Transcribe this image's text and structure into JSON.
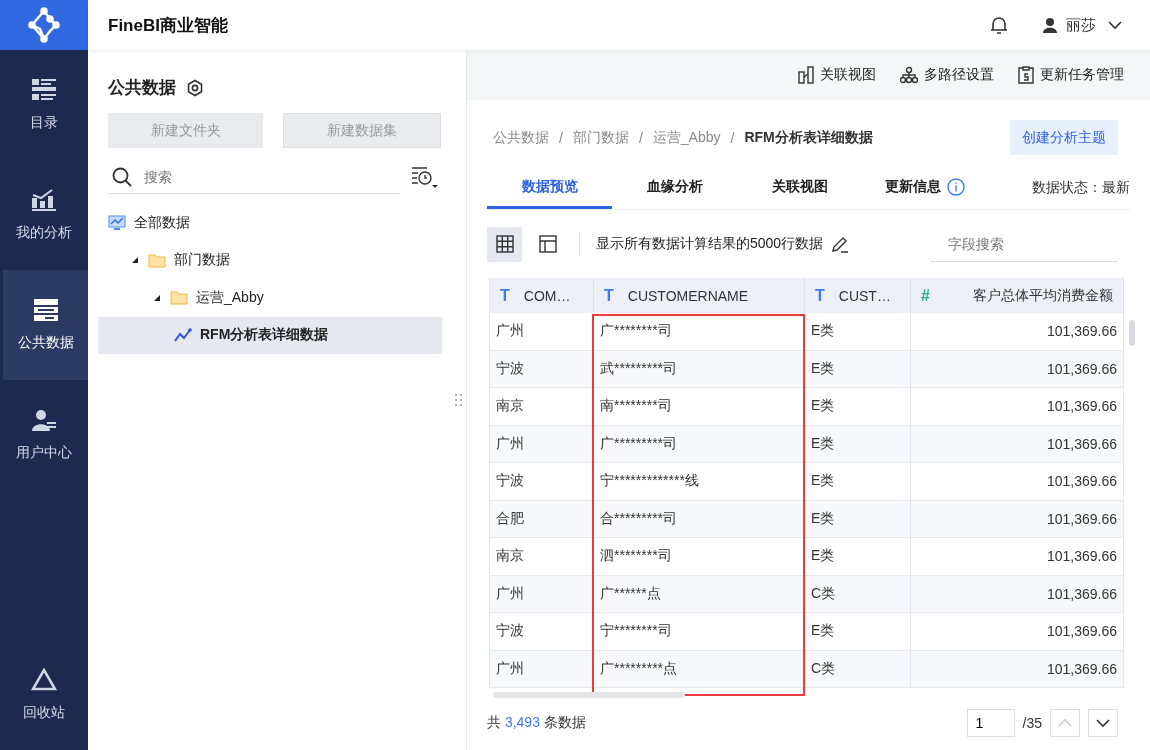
{
  "app": {
    "title": "FineBI商业智能",
    "user": "丽莎"
  },
  "nav": [
    {
      "label": "目录",
      "selected": false
    },
    {
      "label": "我的分析",
      "selected": false
    },
    {
      "label": "公共数据",
      "selected": true
    },
    {
      "label": "用户中心",
      "selected": false
    }
  ],
  "nav_bottom": {
    "label": "回收站"
  },
  "left_panel": {
    "title": "公共数据",
    "buttons": [
      {
        "label": "新建文件夹",
        "disabled": true
      },
      {
        "label": "新建数据集",
        "disabled": true
      }
    ],
    "search": {
      "placeholder": "搜索"
    },
    "tree": [
      {
        "label": "全部数据",
        "kind": "root",
        "selected": false,
        "children": [
          {
            "label": "部门数据",
            "kind": "folder",
            "expanded": true,
            "selected": false,
            "children": [
              {
                "label": "运营_Abby",
                "kind": "folder",
                "expanded": true,
                "selected": false,
                "children": [
                  {
                    "label": "RFM分析表详细数据",
                    "kind": "dataset",
                    "selected": true
                  }
                ]
              }
            ]
          }
        ]
      }
    ]
  },
  "toolbar": [
    "关联视图",
    "多路径设置",
    "更新任务管理"
  ],
  "breadcrumb": {
    "separator": "/",
    "items": [
      "公共数据",
      "部门数据",
      "运营_Abby",
      "RFM分析表详细数据"
    ]
  },
  "create_button": "创建分析主题",
  "tabs": [
    {
      "label": "数据预览",
      "selected": true
    },
    {
      "label": "血缘分析",
      "selected": false
    },
    {
      "label": "关联视图",
      "selected": false
    },
    {
      "label": "更新信息",
      "selected": false
    }
  ],
  "data_status": "数据状态：最新",
  "view_modes": [
    {
      "kind": "grid",
      "selected": true
    },
    {
      "kind": "layout",
      "selected": false
    }
  ],
  "row_notice": "显示所有数据计算结果的5000行数据",
  "field_search": {
    "placeholder": "字段搜索"
  },
  "table": {
    "columns": [
      {
        "type_icon": "T",
        "label": "COM…",
        "kind": "text",
        "highlighted": false
      },
      {
        "type_icon": "T",
        "label": "CUSTOMERNAME",
        "kind": "text",
        "highlighted": true
      },
      {
        "type_icon": "T",
        "label": "CUST…",
        "kind": "text",
        "highlighted": false
      },
      {
        "type_icon": "#",
        "label": "客户总体平均消费金额",
        "kind": "number",
        "highlighted": false
      }
    ],
    "rows": [
      [
        "广州",
        "广********司",
        "E类",
        "101,369.66"
      ],
      [
        "宁波",
        "武*********司",
        "E类",
        "101,369.66"
      ],
      [
        "南京",
        "南********司",
        "E类",
        "101,369.66"
      ],
      [
        "广州",
        "广*********司",
        "E类",
        "101,369.66"
      ],
      [
        "宁波",
        "宁*************线",
        "E类",
        "101,369.66"
      ],
      [
        "合肥",
        "合*********司",
        "E类",
        "101,369.66"
      ],
      [
        "南京",
        "泗********司",
        "E类",
        "101,369.66"
      ],
      [
        "广州",
        "广******点",
        "C类",
        "101,369.66"
      ],
      [
        "宁波",
        "宁********司",
        "E类",
        "101,369.66"
      ],
      [
        "广州",
        "广*********点",
        "C类",
        "101,369.66"
      ]
    ]
  },
  "footer": {
    "prefix": "共",
    "count": "3,493",
    "suffix": "条数据",
    "page": "1",
    "pages": "/35"
  }
}
